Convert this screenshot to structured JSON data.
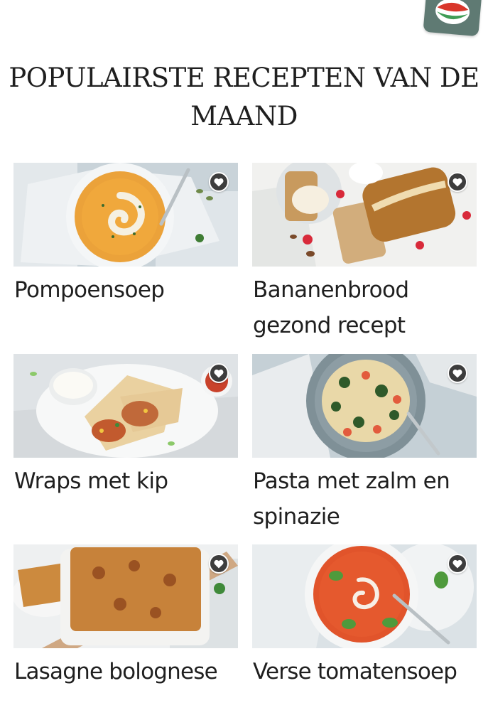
{
  "header": {
    "logo_icon": "brand-logo-icon",
    "title": "POPULAIRSTE RECEPTEN VAN DE MAAND"
  },
  "colors": {
    "logo_bg": "#5f7a73",
    "logo_red": "#d9362b",
    "logo_green": "#3f9c55",
    "favorite_button": "#3d3d3d"
  },
  "recipes": [
    {
      "title": "Pompoensoep",
      "image": "pumpkin-soup-photo",
      "favorite_icon": "heart-icon"
    },
    {
      "title": "Bananenbrood gezond recept",
      "image": "banana-bread-photo",
      "favorite_icon": "heart-icon"
    },
    {
      "title": "Wraps met kip",
      "image": "chicken-wraps-photo",
      "favorite_icon": "heart-icon"
    },
    {
      "title": "Pasta met zalm en spinazie",
      "image": "salmon-spinach-pasta-photo",
      "favorite_icon": "heart-icon"
    },
    {
      "title": "Lasagne bolognese",
      "image": "lasagne-photo",
      "favorite_icon": "heart-icon"
    },
    {
      "title": "Verse tomatensoep",
      "image": "tomato-soup-photo",
      "favorite_icon": "heart-icon"
    }
  ]
}
